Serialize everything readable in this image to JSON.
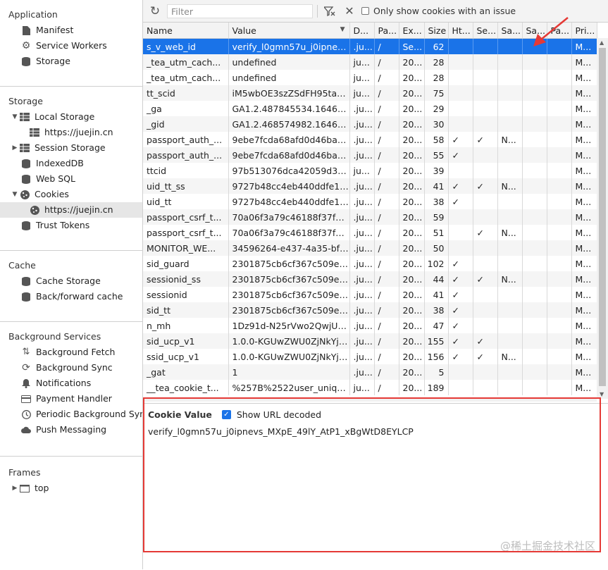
{
  "sidebar": {
    "application": {
      "title": "Application",
      "items": [
        {
          "label": "Manifest",
          "icon": "document-icon"
        },
        {
          "label": "Service Workers",
          "icon": "gear-icon"
        },
        {
          "label": "Storage",
          "icon": "database-icon"
        }
      ]
    },
    "storage": {
      "title": "Storage",
      "local_storage": "Local Storage",
      "local_storage_child": "https://juejin.cn",
      "session_storage": "Session Storage",
      "indexeddb": "IndexedDB",
      "websql": "Web SQL",
      "cookies": "Cookies",
      "cookies_child": "https://juejin.cn",
      "trust_tokens": "Trust Tokens"
    },
    "cache": {
      "title": "Cache",
      "items": [
        {
          "label": "Cache Storage",
          "icon": "database-icon"
        },
        {
          "label": "Back/forward cache",
          "icon": "database-icon"
        }
      ]
    },
    "background": {
      "title": "Background Services",
      "items": [
        {
          "label": "Background Fetch",
          "icon": "arrows-up-down-icon"
        },
        {
          "label": "Background Sync",
          "icon": "sync-icon"
        },
        {
          "label": "Notifications",
          "icon": "bell-icon"
        },
        {
          "label": "Payment Handler",
          "icon": "card-icon"
        },
        {
          "label": "Periodic Background Sync",
          "icon": "clock-icon"
        },
        {
          "label": "Push Messaging",
          "icon": "cloud-icon"
        }
      ]
    },
    "frames": {
      "title": "Frames",
      "top": "top"
    }
  },
  "toolbar": {
    "filter_placeholder": "Filter",
    "only_issues_label": "Only show cookies with an issue"
  },
  "table": {
    "columns": [
      "Name",
      "Value",
      "D...",
      "Pa...",
      "Ex...",
      "Size",
      "Ht...",
      "Se...",
      "Sa...",
      "Sa...",
      "Pa...",
      "Pri..."
    ],
    "rows": [
      [
        "s_v_web_id",
        "verify_l0gmn57u_j0ipnevs...",
        ".ju...",
        "/",
        "Se...",
        "62",
        "",
        "",
        "",
        "",
        "",
        "M..."
      ],
      [
        "_tea_utm_cach...",
        "undefined",
        "ju...",
        "/",
        "20...",
        "28",
        "",
        "",
        "",
        "",
        "",
        "M..."
      ],
      [
        "_tea_utm_cach...",
        "undefined",
        "ju...",
        "/",
        "20...",
        "28",
        "",
        "",
        "",
        "",
        "",
        "M..."
      ],
      [
        "tt_scid",
        "iM5wbOE3szZSdFH95ta9...",
        "ju...",
        "/",
        "20...",
        "75",
        "",
        "",
        "",
        "",
        "",
        "M..."
      ],
      [
        "_ga",
        "GA1.2.487845534.164665...",
        ".ju...",
        "/",
        "20...",
        "29",
        "",
        "",
        "",
        "",
        "",
        "M..."
      ],
      [
        "_gid",
        "GA1.2.468574982.164665...",
        ".ju...",
        "/",
        "20...",
        "30",
        "",
        "",
        "",
        "",
        "",
        "M..."
      ],
      [
        "passport_auth_...",
        "9ebe7fcda68afd0d46ba83...",
        ".ju...",
        "/",
        "20...",
        "58",
        "✓",
        "✓",
        "N...",
        "",
        "",
        "M..."
      ],
      [
        "passport_auth_...",
        "9ebe7fcda68afd0d46ba83...",
        ".ju...",
        "/",
        "20...",
        "55",
        "✓",
        "",
        "",
        "",
        "",
        "M..."
      ],
      [
        "ttcid",
        "97b513076dca42059d3b8...",
        "ju...",
        "/",
        "20...",
        "39",
        "",
        "",
        "",
        "",
        "",
        "M..."
      ],
      [
        "uid_tt_ss",
        "9727b48cc4eb440ddfe19...",
        ".ju...",
        "/",
        "20...",
        "41",
        "✓",
        "✓",
        "N...",
        "",
        "",
        "M..."
      ],
      [
        "uid_tt",
        "9727b48cc4eb440ddfe19...",
        ".ju...",
        "/",
        "20...",
        "38",
        "✓",
        "",
        "",
        "",
        "",
        "M..."
      ],
      [
        "passport_csrf_t...",
        "70a06f3a79c46188f37f33...",
        ".ju...",
        "/",
        "20...",
        "59",
        "",
        "",
        "",
        "",
        "",
        "M..."
      ],
      [
        "passport_csrf_t...",
        "70a06f3a79c46188f37f33...",
        ".ju...",
        "/",
        "20...",
        "51",
        "",
        "✓",
        "N...",
        "",
        "",
        "M..."
      ],
      [
        "MONITOR_WE...",
        "34596264-e437-4a35-bfa...",
        ".ju...",
        "/",
        "20...",
        "50",
        "",
        "",
        "",
        "",
        "",
        "M..."
      ],
      [
        "sid_guard",
        "2301875cb6cf367c509e3a...",
        ".ju...",
        "/",
        "20...",
        "102",
        "✓",
        "",
        "",
        "",
        "",
        "M..."
      ],
      [
        "sessionid_ss",
        "2301875cb6cf367c509e3a...",
        ".ju...",
        "/",
        "20...",
        "44",
        "✓",
        "✓",
        "N...",
        "",
        "",
        "M..."
      ],
      [
        "sessionid",
        "2301875cb6cf367c509e3a...",
        ".ju...",
        "/",
        "20...",
        "41",
        "✓",
        "",
        "",
        "",
        "",
        "M..."
      ],
      [
        "sid_tt",
        "2301875cb6cf367c509e3a...",
        ".ju...",
        "/",
        "20...",
        "38",
        "✓",
        "",
        "",
        "",
        "",
        "M..."
      ],
      [
        "n_mh",
        "1Dz91d-N25rVwo2QwjU7...",
        ".ju...",
        "/",
        "20...",
        "47",
        "✓",
        "",
        "",
        "",
        "",
        "M..."
      ],
      [
        "sid_ucp_v1",
        "1.0.0-KGUwZWU0ZjNkYjc...",
        ".ju...",
        "/",
        "20...",
        "155",
        "✓",
        "✓",
        "",
        "",
        "",
        "M..."
      ],
      [
        "ssid_ucp_v1",
        "1.0.0-KGUwZWU0ZjNkYjc...",
        ".ju...",
        "/",
        "20...",
        "156",
        "✓",
        "✓",
        "N...",
        "",
        "",
        "M..."
      ],
      [
        "_gat",
        "1",
        ".ju...",
        "/",
        "20...",
        "5",
        "",
        "",
        "",
        "",
        "",
        "M..."
      ],
      [
        "__tea_cookie_t...",
        "%257B%2522user_unique...",
        "ju...",
        "/",
        "20...",
        "189",
        "",
        "",
        "",
        "",
        "",
        "M..."
      ]
    ]
  },
  "cookie_panel": {
    "title": "Cookie Value",
    "decode_label": "Show URL decoded",
    "value": "verify_l0gmn57u_j0ipnevs_MXpE_49lY_AtP1_xBgWtD8EYLCP"
  },
  "watermark": "@稀土掘金技术社区",
  "colors": {
    "selection": "#1a73e8",
    "annotation": "#e53935"
  }
}
